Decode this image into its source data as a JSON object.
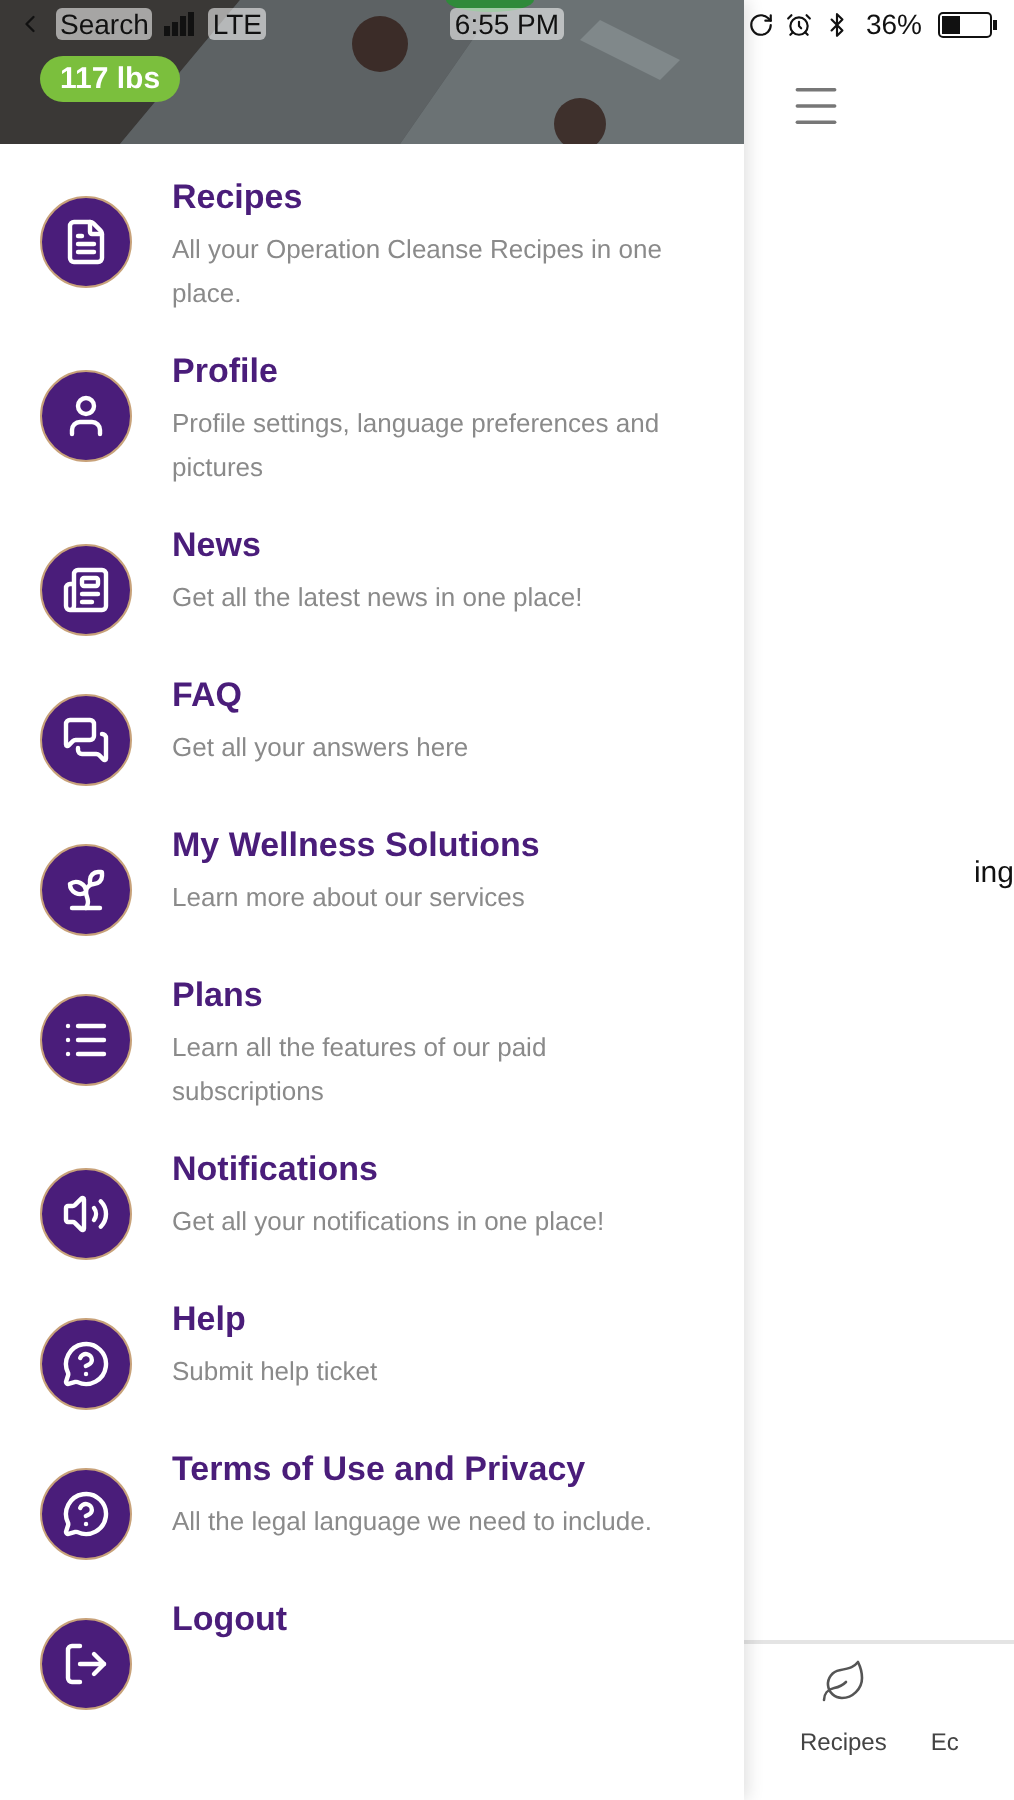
{
  "status_bar": {
    "back_label": "Search",
    "carrier": "LTE",
    "time": "6:55 PM",
    "battery": "36%"
  },
  "header": {
    "weight": "117 lbs"
  },
  "menu": [
    {
      "kind": "recipes",
      "title": "Recipes",
      "description": "All your Operation Cleanse Recipes in one place."
    },
    {
      "kind": "profile",
      "title": "Profile",
      "description": "Profile settings, language preferences and pictures"
    },
    {
      "kind": "news",
      "title": "News",
      "description": "Get all the latest news in one place!"
    },
    {
      "kind": "faq",
      "title": "FAQ",
      "description": "Get all your answers here"
    },
    {
      "kind": "wellness",
      "title": "My Wellness Solutions",
      "description": "Learn more about our services"
    },
    {
      "kind": "plans",
      "title": "Plans",
      "description": "Learn all the features of our paid subscriptions"
    },
    {
      "kind": "notifications",
      "title": "Notifications",
      "description": "Get all your notifications in one place!"
    },
    {
      "kind": "help",
      "title": "Help",
      "description": "Submit help ticket"
    },
    {
      "kind": "help",
      "title": "Terms of Use and Privacy",
      "description": "All the legal language we need to include."
    },
    {
      "kind": "logout",
      "title": "Logout"
    }
  ],
  "main": {
    "text": "ing",
    "tabs": [
      {
        "kind": "leaf",
        "label": "Recipes"
      },
      {
        "kind": "plain",
        "label": "Ec"
      }
    ]
  }
}
